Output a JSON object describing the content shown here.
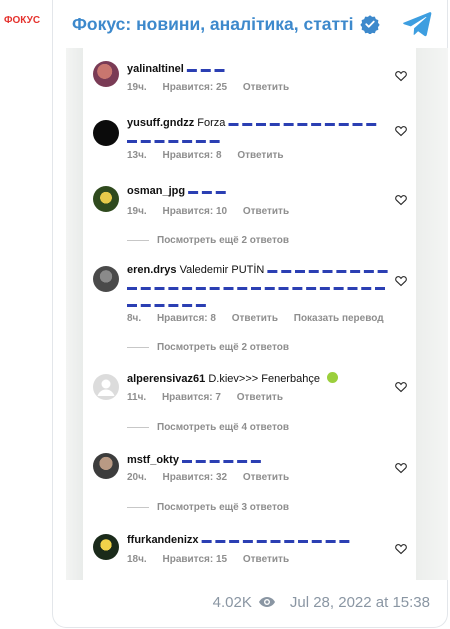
{
  "channel": {
    "logo_text": "ФОКУС",
    "title": "Фокус: новини, аналітика, статті"
  },
  "comments": [
    {
      "user": "yalinaltinel",
      "text": "",
      "flags": "▬ ▬ ▬",
      "time": "19ч.",
      "likes": "Нравится: 25",
      "reply": "Ответить",
      "translate": ""
    },
    {
      "user": "yusuff.gndzz",
      "text": "Forza",
      "flags": "▬ ▬ ▬ ▬ ▬ ▬ ▬ ▬ ▬ ▬ ▬ ▬ ▬ ▬ ▬ ▬ ▬ ▬",
      "time": "13ч.",
      "likes": "Нравится: 8",
      "reply": "Ответить",
      "translate": ""
    },
    {
      "user": "osman_jpg",
      "text": "",
      "flags": "▬ ▬ ▬",
      "time": "19ч.",
      "likes": "Нравится: 10",
      "reply": "Ответить",
      "translate": ""
    },
    {
      "user": "eren.drys",
      "text": "Valedemir PUTİN",
      "flags": "▬ ▬ ▬ ▬ ▬ ▬ ▬ ▬ ▬ ▬ ▬ ▬ ▬ ▬ ▬ ▬ ▬ ▬ ▬ ▬ ▬ ▬ ▬ ▬ ▬ ▬ ▬ ▬ ▬ ▬ ▬ ▬ ▬ ▬",
      "time": "8ч.",
      "likes": "Нравится: 8",
      "reply": "Ответить",
      "translate": "Показать перевод"
    },
    {
      "user": "alperensivaz61",
      "text": "D.kiev>>> Fenerbahçe",
      "flags": "",
      "time": "11ч.",
      "likes": "Нравится: 7",
      "reply": "Ответить",
      "translate": ""
    },
    {
      "user": "mstf_okty",
      "text": "",
      "flags": "▬ ▬ ▬ ▬ ▬ ▬",
      "time": "20ч.",
      "likes": "Нравится: 32",
      "reply": "Ответить",
      "translate": ""
    },
    {
      "user": "ffurkandenizx",
      "text": "",
      "flags": "▬ ▬ ▬ ▬ ▬ ▬ ▬ ▬ ▬ ▬ ▬",
      "time": "18ч.",
      "likes": "Нравится: 15",
      "reply": "Ответить",
      "translate": ""
    }
  ],
  "more_replies": [
    "Посмотреть ещё 2 ответов",
    "Посмотреть ещё 2 ответов",
    "Посмотреть ещё 4 ответов",
    "Посмотреть ещё 3 ответов"
  ],
  "footer": {
    "views": "4.02K",
    "date": "Jul 28, 2022 at 15:38"
  },
  "colors": {
    "channel_title": "#3d89cc",
    "logo": "#e5322d",
    "meta_gray": "#8e8e8e",
    "footer_gray": "#8a96a3",
    "verified_blue": "#3d89cc",
    "telegram_blue": "#3d9ee0"
  }
}
